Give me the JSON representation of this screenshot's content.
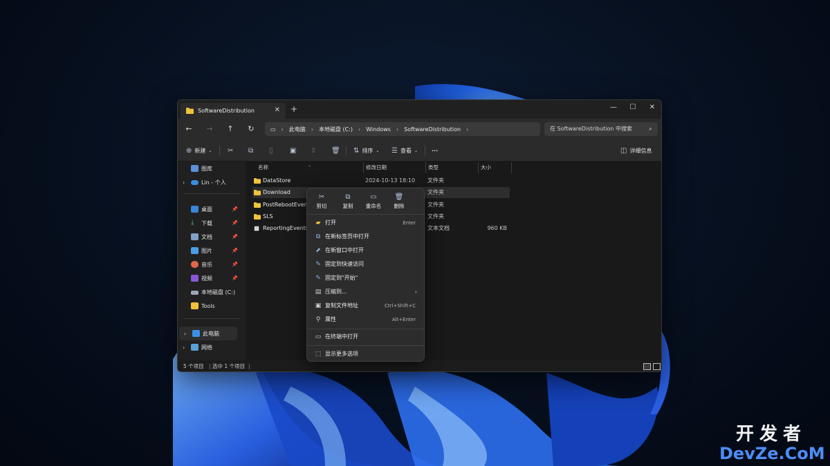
{
  "tab": {
    "title": "SoftwareDistribution",
    "close": "✕",
    "new_tab": "+"
  },
  "window_controls": {
    "minimize": "—",
    "maximize": "☐",
    "close": "✕"
  },
  "nav": {
    "back": "←",
    "forward": "→",
    "up": "↑",
    "refresh": "↻"
  },
  "address": {
    "segments": [
      "此电脑",
      "本地磁盘 (C:)",
      "Windows",
      "SoftwareDistribution"
    ],
    "separator": "›"
  },
  "search": {
    "placeholder": "在 SoftwareDistribution 中搜索"
  },
  "toolbar": {
    "new_label": "新建",
    "sort_label": "排序",
    "view_label": "查看",
    "more_label": "···",
    "details_label": "详细信息"
  },
  "sidebar": {
    "items": [
      {
        "label": "图库",
        "icon": "gallery-icon"
      },
      {
        "label": "Lin - 个人",
        "icon": "onedrive-icon"
      },
      {
        "label": "桌面",
        "icon": "desktop-icon"
      },
      {
        "label": "下载",
        "icon": "download-icon"
      },
      {
        "label": "文档",
        "icon": "documents-icon"
      },
      {
        "label": "图片",
        "icon": "pictures-icon"
      },
      {
        "label": "音乐",
        "icon": "music-icon"
      },
      {
        "label": "视频",
        "icon": "videos-icon"
      },
      {
        "label": "本地磁盘 (C:)",
        "icon": "drive-icon"
      },
      {
        "label": "Tools",
        "icon": "folder-icon"
      },
      {
        "label": "此电脑",
        "icon": "this-pc-icon"
      },
      {
        "label": "网络",
        "icon": "network-icon"
      }
    ]
  },
  "columns": {
    "name": "名称",
    "date": "修改日期",
    "type": "类型",
    "size": "大小"
  },
  "files": [
    {
      "name": "DataStore",
      "date": "2024-10-13 18:10",
      "type": "文件夹",
      "size": ""
    },
    {
      "name": "Download",
      "date": "",
      "type": "文件夹",
      "size": ""
    },
    {
      "name": "PostRebootEventC",
      "date": "",
      "type": "文件夹",
      "size": ""
    },
    {
      "name": "SLS",
      "date": "",
      "type": "文件夹",
      "size": ""
    },
    {
      "name": "ReportingEvents.lo",
      "date": "",
      "type": "文本文档",
      "size": "960 KB"
    }
  ],
  "status": {
    "count": "5 个项目",
    "selected": "选中 1 个项目"
  },
  "context_menu": {
    "quick_actions": [
      {
        "label": "剪切",
        "icon": "scissors-icon",
        "glyph": "✂"
      },
      {
        "label": "复制",
        "icon": "copy-icon",
        "glyph": "⧉"
      },
      {
        "label": "重命名",
        "icon": "rename-icon",
        "glyph": "▭"
      },
      {
        "label": "删除",
        "icon": "trash-icon",
        "glyph": "🗑"
      }
    ],
    "items": [
      {
        "label": "打开",
        "shortcut": "Enter"
      },
      {
        "label": "在新标签页中打开",
        "shortcut": ""
      },
      {
        "label": "在新窗口中打开",
        "shortcut": ""
      },
      {
        "label": "固定到快速访问",
        "shortcut": ""
      },
      {
        "label": "固定到\"开始\"",
        "shortcut": ""
      },
      {
        "label": "压缩到...",
        "shortcut": ""
      },
      {
        "label": "复制文件地址",
        "shortcut": "Ctrl+Shift+C"
      },
      {
        "label": "属性",
        "shortcut": "Alt+Enter"
      },
      {
        "label": "在终端中打开",
        "shortcut": ""
      },
      {
        "label": "显示更多选项",
        "shortcut": ""
      }
    ]
  },
  "watermark": {
    "top": "开发者",
    "bottom": "DevZe.CoM"
  },
  "colors": {
    "accent": "#4d8df5",
    "folder": "#f0c23b",
    "window_bg": "#1c1c1c"
  }
}
